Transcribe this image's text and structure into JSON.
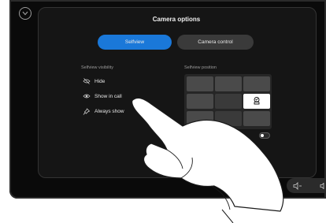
{
  "header": {
    "title": "Camera options"
  },
  "tabs": [
    {
      "label": "Selfview",
      "active": true
    },
    {
      "label": "Camera control",
      "active": false
    }
  ],
  "selfview_visibility": {
    "heading": "Selfview visibility",
    "options": [
      {
        "label": "Hide",
        "icon": "eye-slash-icon"
      },
      {
        "label": "Show in call",
        "icon": "eye-icon"
      },
      {
        "label": "Always show",
        "icon": "pin-icon"
      }
    ]
  },
  "selfview_position": {
    "heading": "Selfview position",
    "selected_cell": "middle-right"
  },
  "colors": {
    "accent": "#1a78d9",
    "panel": "#151515"
  }
}
